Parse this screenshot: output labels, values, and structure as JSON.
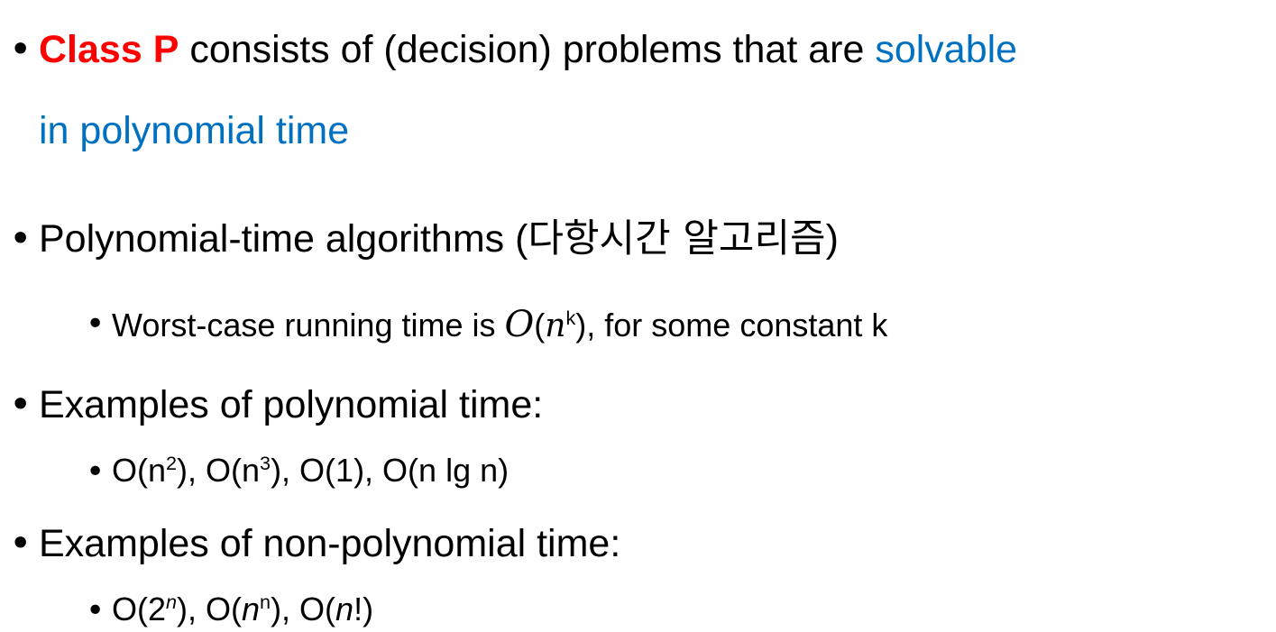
{
  "slide": {
    "bullet_char": "•",
    "item1": {
      "keyword": "Class P",
      "middle": " consists of (decision) problems that are ",
      "highlight_line1": "solvable",
      "highlight_line2": "in polynomial time"
    },
    "item2": {
      "text": "Polynomial-time algorithms (",
      "korean": "다항시간 알고리즘",
      "close": ")",
      "sub": {
        "prefix": "Worst-case running time is ",
        "math_o": "O",
        "paren_open": "(",
        "math_n": "n",
        "exponent": "k",
        "paren_close": ")",
        "suffix": ", for some constant k"
      }
    },
    "item3": {
      "text": "Examples of polynomial time:",
      "sub": {
        "part1": "O(n",
        "sup1": "2",
        "part2": "), O(n",
        "sup2": "3",
        "part3": "), O(1), O(n lg n)"
      }
    },
    "item4": {
      "text": "Examples of non-polynomial time:",
      "sub": {
        "part1": "O(2",
        "sup1": "n",
        "part2": "), O(",
        "n1": "n",
        "sup2": "n",
        "part3": "), O(",
        "n2": "n",
        "part4": "!)"
      }
    }
  }
}
